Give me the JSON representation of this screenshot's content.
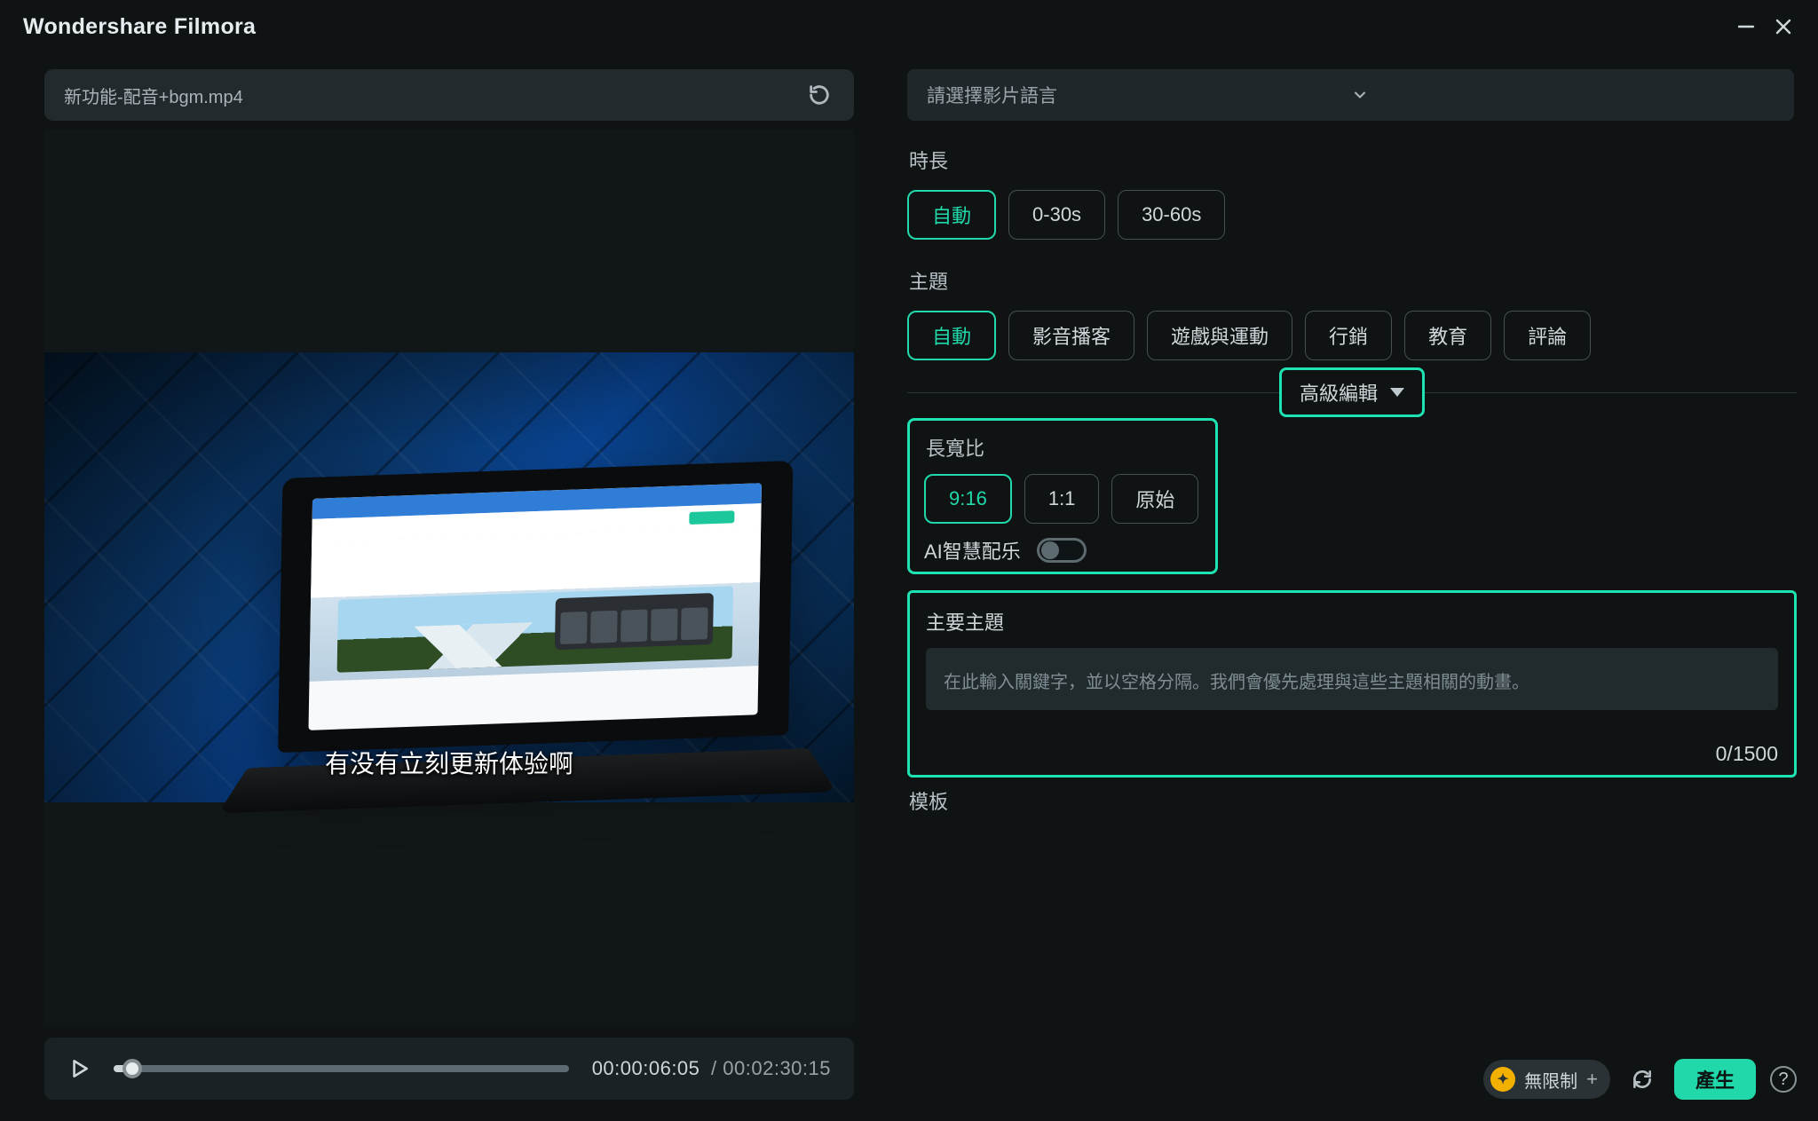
{
  "app": {
    "title": "Wondershare Filmora"
  },
  "file": {
    "name": "新功能-配音+bgm.mp4"
  },
  "video": {
    "subtitle": "有没有立刻更新体验啊",
    "cur": "00:00:06:05",
    "dur": "/ 00:02:30:15"
  },
  "lang": {
    "placeholder": "請選擇影片語言"
  },
  "duration": {
    "label": "時長",
    "auto": "自動",
    "r0": "0-30s",
    "r1": "30-60s"
  },
  "theme": {
    "label": "主題",
    "auto": "自動",
    "vlog": "影音播客",
    "game": "遊戲與運動",
    "marketing": "行銷",
    "edu": "教育",
    "review": "評論"
  },
  "advanced": {
    "label": "高級編輯"
  },
  "aspect": {
    "label": "長寬比",
    "o0": "9:16",
    "o1": "1:1",
    "o2": "原始"
  },
  "ai_music": {
    "label": "AI智慧配乐"
  },
  "topic": {
    "label": "主要主題",
    "placeholder": "在此輸入關鍵字，並以空格分隔。我們會優先處理與這些主題相關的動畫。",
    "count": "0/1500"
  },
  "templates": {
    "label": "模板"
  },
  "footer": {
    "unlimited": "無限制",
    "generate": "產生"
  }
}
